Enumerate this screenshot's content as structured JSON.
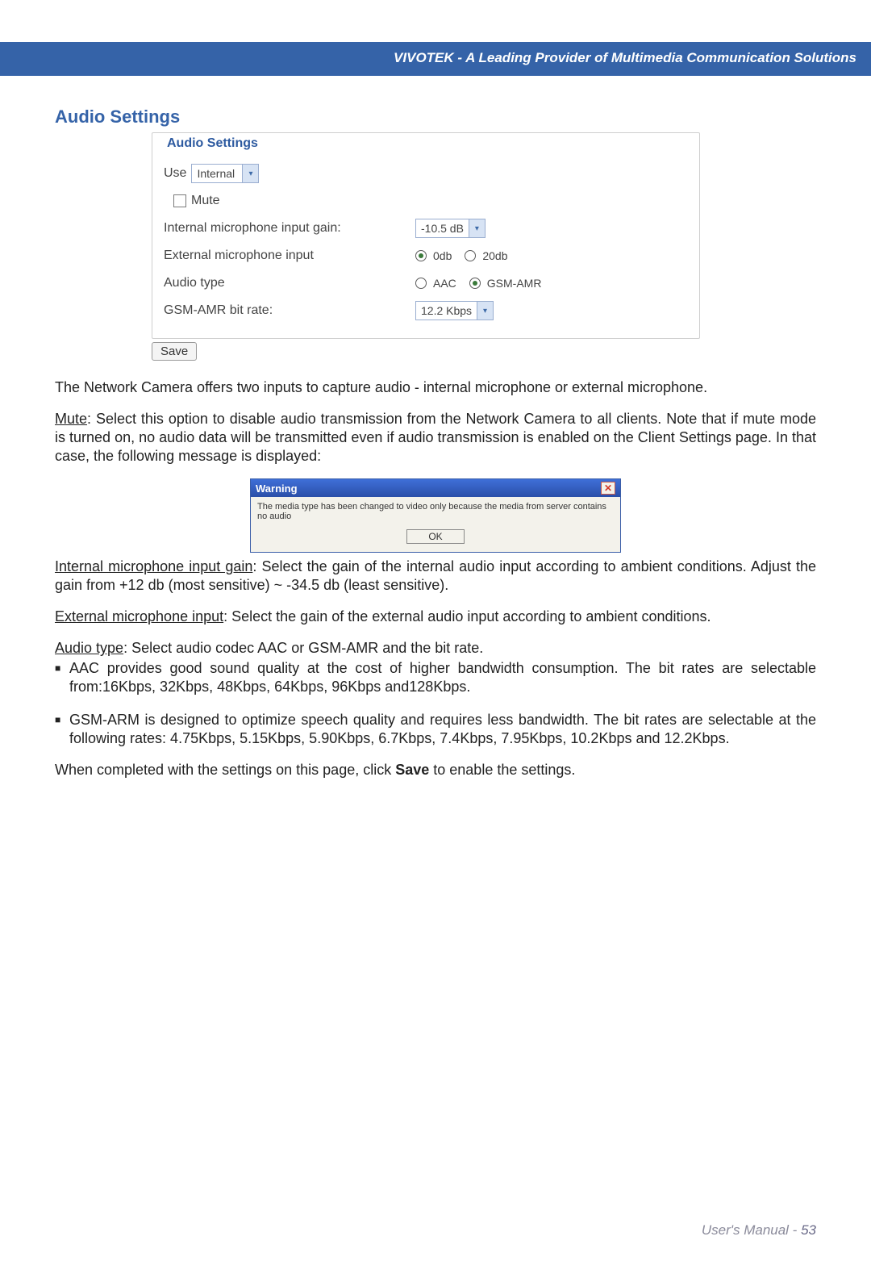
{
  "header": {
    "brand_text": "VIVOTEK - A Leading Provider of Multimedia Communication Solutions"
  },
  "section": {
    "title": "Audio Settings"
  },
  "fieldset": {
    "legend": "Audio Settings",
    "use_label": "Use",
    "use_value": "Internal",
    "mute_label": "Mute",
    "internal_gain_label": "Internal microphone input gain:",
    "internal_gain_value": "-10.5 dB",
    "external_input_label": "External microphone input",
    "external_opt_0db": "0db",
    "external_opt_20db": "20db",
    "audio_type_label": "Audio type",
    "audio_type_aac": "AAC",
    "audio_type_gsm": "GSM-AMR",
    "bitrate_label": "GSM-AMR bit rate:",
    "bitrate_value": "12.2 Kbps",
    "save_label": "Save"
  },
  "paragraphs": {
    "p1": "The Network Camera offers two inputs to capture audio - internal microphone or external microphone.",
    "mute_u": "Mute",
    "mute_rest": ": Select this option to disable audio transmission from the Network Camera to all clients. Note that if mute mode is turned on, no audio data will be transmitted even if audio transmission is enabled on the Client Settings page. In that case, the following message is displayed:",
    "intgain_u": "Internal microphone input gain",
    "intgain_rest": ": Select the gain of the internal audio input according to ambient conditions. Adjust the gain from +12 db (most sensitive) ~ -34.5 db (least sensitive).",
    "ext_u": "External microphone input",
    "ext_rest": ": Select the gain of the external audio input according to ambient conditions.",
    "atype_u": "Audio type",
    "atype_rest": ": Select audio codec AAC or GSM-AMR and the bit rate.",
    "bullet_aac": "AAC provides good sound quality at the cost of higher bandwidth consumption. The bit rates are selectable from:16Kbps, 32Kbps, 48Kbps, 64Kbps, 96Kbps and128Kbps.",
    "bullet_gsm": "GSM-ARM is designed to optimize speech quality and requires less bandwidth. The bit rates are selectable at the following rates: 4.75Kbps, 5.15Kbps, 5.90Kbps, 6.7Kbps, 7.4Kbps, 7.95Kbps, 10.2Kbps and 12.2Kbps.",
    "final_pre": "When completed with the settings on this page, click ",
    "final_bold": "Save",
    "final_post": " to enable the settings."
  },
  "dialog": {
    "title": "Warning",
    "message": "The media type has been changed to video only because the media from server contains no audio",
    "ok": "OK"
  },
  "footer": {
    "label": "User's Manual - ",
    "page": "53"
  }
}
